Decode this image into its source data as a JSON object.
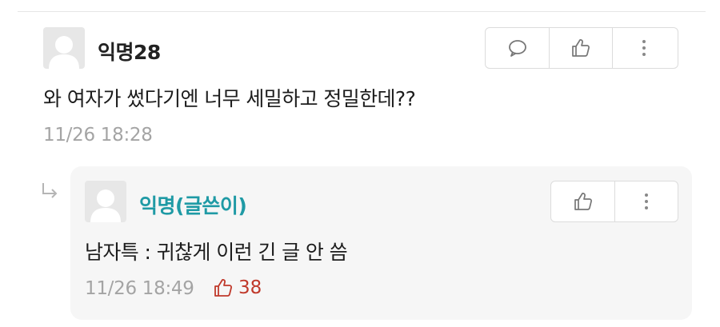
{
  "comment": {
    "author": "익명28",
    "text": "와 여자가 썼다기엔 너무 세밀하고 정밀한데??",
    "timestamp": "11/26 18:28",
    "actions": [
      {
        "name": "reply-icon"
      },
      {
        "name": "thumbs-up-icon"
      },
      {
        "name": "more-icon"
      }
    ]
  },
  "reply": {
    "author": "익명(글쓴이)",
    "text": "남자특 : 귀찮게 이런 긴 글 안 씀",
    "timestamp": "11/26 18:49",
    "likes": "38",
    "actions": [
      {
        "name": "thumbs-up-icon"
      },
      {
        "name": "more-icon"
      }
    ]
  },
  "colors": {
    "op_author": "#1f9aa5",
    "like": "#c0392b",
    "timestamp": "#a4a4a4"
  }
}
